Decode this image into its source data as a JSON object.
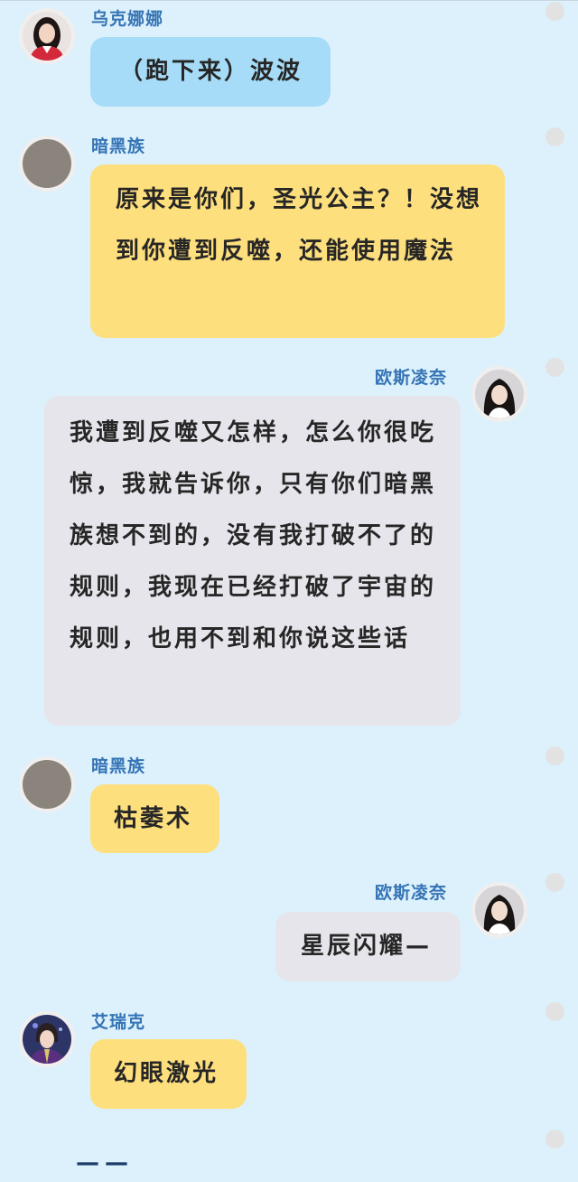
{
  "messages": [
    {
      "speaker": "乌克娜娜",
      "text": "（跑下来）波波",
      "side": "left",
      "color": "#a6dcf8",
      "avatar": "female-portrait-red-outfit"
    },
    {
      "speaker": "暗黑族",
      "text": "原来是你们，圣光公主？！没想到你遭到反噬，还能使用魔法",
      "side": "left",
      "color": "#fedf7d",
      "avatar": "gray-blank-avatar"
    },
    {
      "speaker": "欧斯凌奈",
      "text": "我遭到反噬又怎样，怎么你很吃惊，我就告诉你，只有你们暗黑族想不到的，没有我打破不了的规则，我现在已经打破了宇宙的规则，也用不到和你说这些话",
      "side": "right",
      "color": "#e5e5eb",
      "avatar": "female-portrait-dark-hair"
    },
    {
      "speaker": "暗黑族",
      "text": "枯萎术",
      "side": "left",
      "color": "#fedf7d",
      "avatar": "gray-blank-avatar"
    },
    {
      "speaker": "欧斯凌奈",
      "text": "星辰闪耀—",
      "side": "right",
      "color": "#e5e5eb",
      "avatar": "female-portrait-dark-hair"
    },
    {
      "speaker": "艾瑞克",
      "text": "幻眼激光",
      "side": "left",
      "color": "#fedf7d",
      "avatar": "male-portrait-purple-uniform"
    }
  ],
  "footer_text": "——"
}
